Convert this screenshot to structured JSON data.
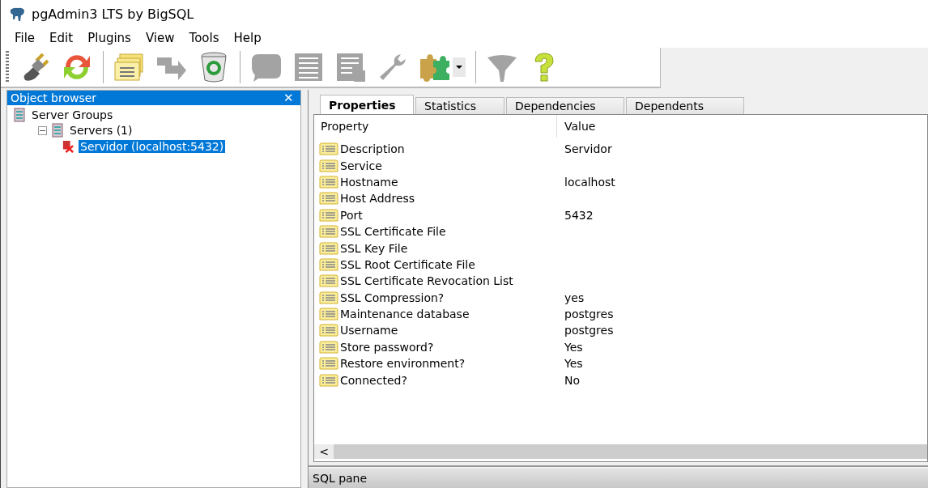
{
  "window": {
    "title": "pgAdmin3 LTS by BigSQL"
  },
  "menu": [
    "File",
    "Edit",
    "Plugins",
    "View",
    "Tools",
    "Help"
  ],
  "toolbar": [
    {
      "kind": "plug",
      "disabled": false
    },
    {
      "kind": "refresh",
      "disabled": false
    },
    {
      "kind": "separator"
    },
    {
      "kind": "folders",
      "disabled": false
    },
    {
      "kind": "arrows",
      "disabled": true
    },
    {
      "kind": "trash",
      "disabled": false
    },
    {
      "kind": "separator"
    },
    {
      "kind": "bubble",
      "disabled": true
    },
    {
      "kind": "list",
      "disabled": true
    },
    {
      "kind": "report",
      "disabled": true
    },
    {
      "kind": "wrench",
      "disabled": true
    },
    {
      "kind": "puzzle",
      "disabled": false
    },
    {
      "kind": "dropdown",
      "disabled": false
    },
    {
      "kind": "separator"
    },
    {
      "kind": "funnel",
      "disabled": true
    },
    {
      "kind": "help",
      "disabled": false
    }
  ],
  "object_browser": {
    "title": "Object browser",
    "close": "✕",
    "tree": [
      {
        "label": "Server Groups",
        "kind": "group",
        "selected": false,
        "children": [
          {
            "label": "Servers (1)",
            "kind": "group",
            "selected": false,
            "expanded": true,
            "children": [
              {
                "label": "Servidor (localhost:5432)",
                "kind": "server",
                "selected": true
              }
            ]
          }
        ]
      }
    ]
  },
  "tabs": [
    {
      "label": "Properties",
      "selected": true
    },
    {
      "label": "Statistics",
      "selected": false
    },
    {
      "label": "Dependencies",
      "selected": false
    },
    {
      "label": "Dependents",
      "selected": false
    }
  ],
  "properties": {
    "columns": [
      "Property",
      "Value"
    ],
    "rows": [
      {
        "property": "Description",
        "value": "Servidor"
      },
      {
        "property": "Service"
      },
      {
        "property": "Hostname",
        "value": "localhost"
      },
      {
        "property": "Host Address"
      },
      {
        "property": "Port",
        "value": "5432"
      },
      {
        "property": "SSL Certificate File"
      },
      {
        "property": "SSL Key File"
      },
      {
        "property": "SSL Root Certificate File"
      },
      {
        "property": "SSL Certificate Revocation List"
      },
      {
        "property": "SSL Compression?",
        "value": "yes"
      },
      {
        "property": "Maintenance database",
        "value": "postgres"
      },
      {
        "property": "Username",
        "value": "postgres"
      },
      {
        "property": "Store password?",
        "value": "Yes"
      },
      {
        "property": "Restore environment?",
        "value": "Yes"
      },
      {
        "property": "Connected?",
        "value": "No"
      }
    ],
    "scroll_left": "<"
  },
  "sql_pane": {
    "title": "SQL pane"
  }
}
